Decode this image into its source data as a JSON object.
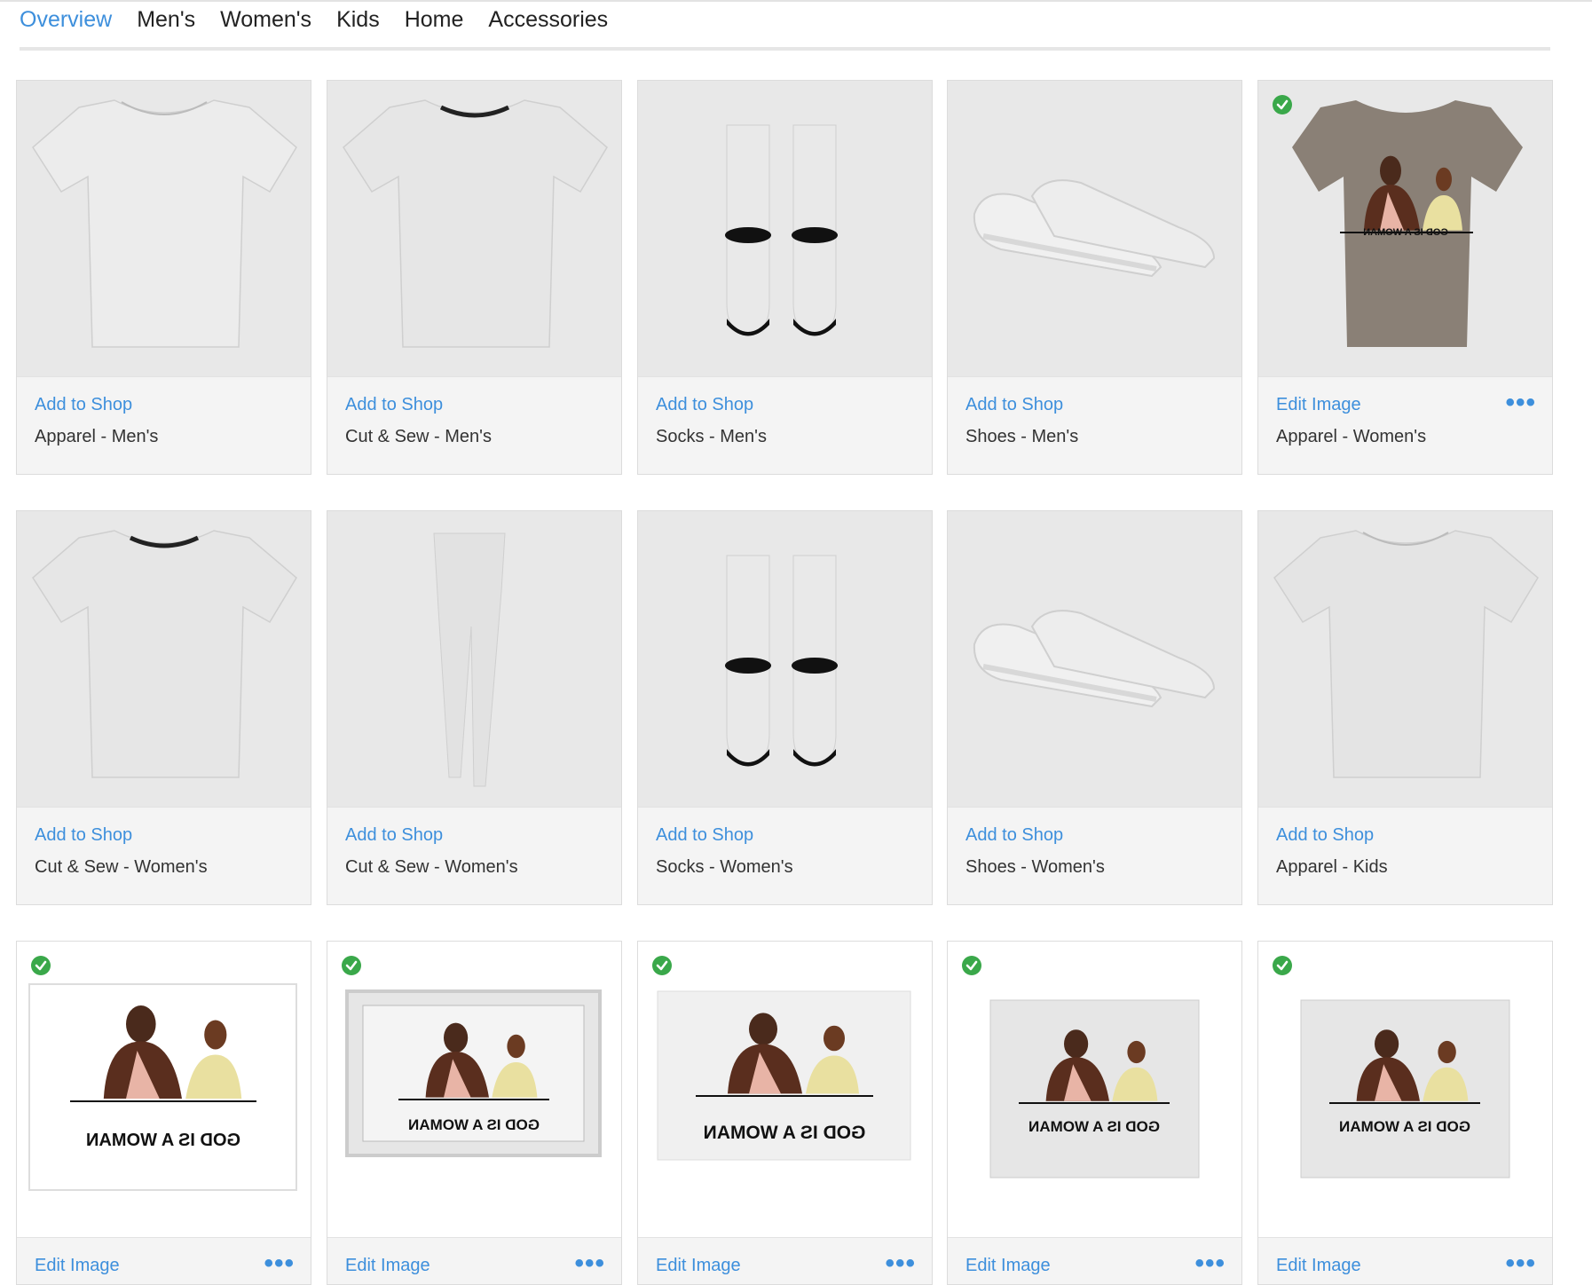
{
  "tabs": [
    "Overview",
    "Men's",
    "Women's",
    "Kids",
    "Home",
    "Accessories"
  ],
  "colors": {
    "accent": "#3d8fdc",
    "check": "#3aa84a",
    "tshirt_women": "#8a8076"
  },
  "design_caption": "GOD IS A WOMAN",
  "products": [
    {
      "link": "Add to Shop",
      "label": "Apparel - Men's",
      "icon": "tshirt-image",
      "checked": false,
      "more": false
    },
    {
      "link": "Add to Shop",
      "label": "Cut & Sew - Men's",
      "icon": "tshirt-collar-image",
      "checked": false,
      "more": false
    },
    {
      "link": "Add to Shop",
      "label": "Socks - Men's",
      "icon": "socks-image",
      "checked": false,
      "more": false
    },
    {
      "link": "Add to Shop",
      "label": "Shoes - Men's",
      "icon": "shoes-image",
      "checked": false,
      "more": false
    },
    {
      "link": "Edit Image",
      "label": "Apparel - Women's",
      "icon": "tshirt-design-image",
      "checked": true,
      "more": true
    },
    {
      "link": "Add to Shop",
      "label": "Cut & Sew - Women's",
      "icon": "tshirt-collar-image",
      "checked": false,
      "more": false
    },
    {
      "link": "Add to Shop",
      "label": "Cut & Sew - Women's",
      "icon": "leggings-image",
      "checked": false,
      "more": false
    },
    {
      "link": "Add to Shop",
      "label": "Socks - Women's",
      "icon": "socks-image",
      "checked": false,
      "more": false
    },
    {
      "link": "Add to Shop",
      "label": "Shoes - Women's",
      "icon": "shoes-image",
      "checked": false,
      "more": false
    },
    {
      "link": "Add to Shop",
      "label": "Apparel - Kids",
      "icon": "kids-tshirt-image",
      "checked": false,
      "more": false
    },
    {
      "link": "Edit Image",
      "label": "",
      "icon": "sticker-image",
      "checked": true,
      "more": true
    },
    {
      "link": "Edit Image",
      "label": "",
      "icon": "framed-print-image",
      "checked": true,
      "more": true
    },
    {
      "link": "Edit Image",
      "label": "",
      "icon": "art-print-image",
      "checked": true,
      "more": true
    },
    {
      "link": "Edit Image",
      "label": "",
      "icon": "canvas-print-image",
      "checked": true,
      "more": true
    },
    {
      "link": "Edit Image",
      "label": "",
      "icon": "canvas-print-image",
      "checked": true,
      "more": true
    }
  ],
  "more_label": "•••"
}
